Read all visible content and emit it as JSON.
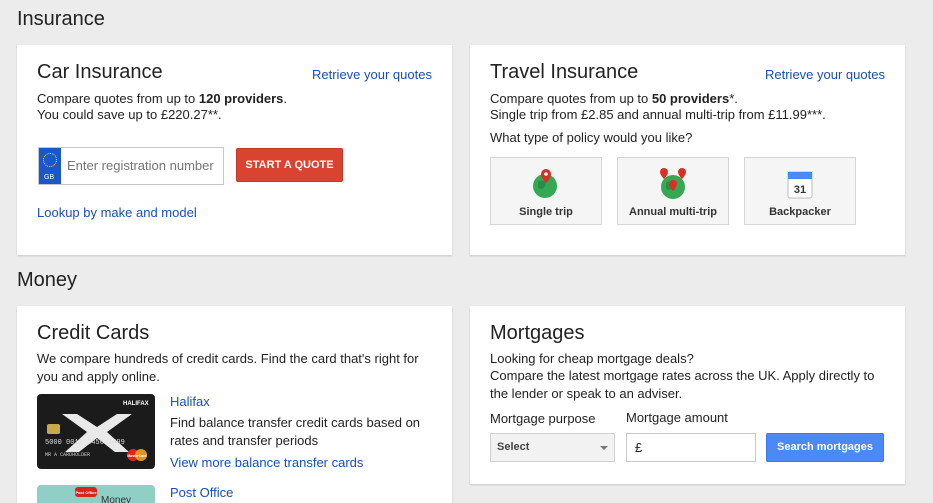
{
  "sections": {
    "insurance": "Insurance",
    "money": "Money"
  },
  "car": {
    "title": "Car Insurance",
    "retrieve_link": "Retrieve your quotes",
    "line1_pre": "Compare quotes from up to ",
    "line1_bold": "120 providers",
    "line1_post": ".",
    "line2": "You could save up to £220.27**.",
    "reg_placeholder": "Enter registration number",
    "flag_label": "GB",
    "start_button": "START A QUOTE",
    "lookup_link": "Lookup by make and model"
  },
  "travel": {
    "title": "Travel Insurance",
    "retrieve_link": "Retrieve your quotes",
    "line1_pre": "Compare quotes from up to ",
    "line1_bold": "50 providers",
    "line1_post": "*.",
    "line2": "Single trip from £2.85 and annual multi-trip from £11.99***.",
    "question": "What type of policy would you like?",
    "options": [
      {
        "label": "Single trip",
        "icon": "globe-pin-icon"
      },
      {
        "label": "Annual multi-trip",
        "icon": "globe-multi-pin-icon"
      },
      {
        "label": "Backpacker",
        "icon": "calendar-icon",
        "calendar_day": "31"
      }
    ]
  },
  "credit": {
    "title": "Credit Cards",
    "intro": "We compare hundreds of credit cards. Find the card that's right for you and apply online.",
    "offers": [
      {
        "provider": "Halifax",
        "desc": "Find balance transfer credit cards based on rates and transfer periods",
        "link": "View more balance transfer cards",
        "card_brand": "HALIFAX",
        "card_number": "5000 0012 3456 7899",
        "card_holder": "MR A CARDHOLDER",
        "card_network": "MasterCard"
      },
      {
        "provider": "Post Office",
        "card_brand": "Post Office",
        "card_label": "Money"
      }
    ]
  },
  "mortgages": {
    "title": "Mortgages",
    "line1": "Looking for cheap mortgage deals?",
    "line2": "Compare the latest mortgage rates across the UK. Apply directly to the lender or speak to an adviser.",
    "purpose_label": "Mortgage purpose",
    "purpose_value": "Select",
    "amount_label": "Mortgage amount",
    "amount_prefix": "£",
    "search_button": "Search mortgages"
  },
  "colors": {
    "link": "#1a4eb8",
    "start_button": "#d9432f",
    "search_button": "#4a8af4",
    "globe": "#34a853",
    "pin": "#d93025"
  }
}
